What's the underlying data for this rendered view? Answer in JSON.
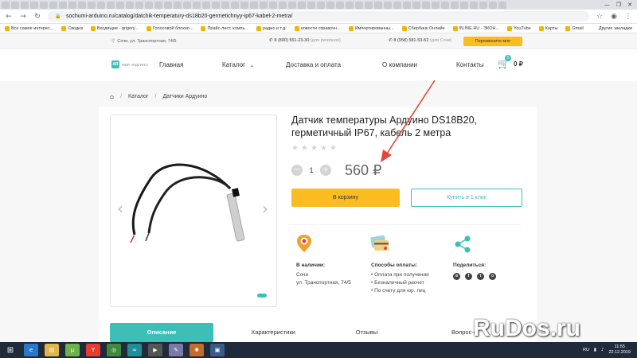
{
  "browser": {
    "url": "sochumi-arduino.ru/catalog/datchik-temperatury-ds18b20-germetichnyy-ip67-kabel-2-metra/",
    "bookmarks": [
      "Все самое интерес...",
      "Сводка",
      "Входящие - grigory...",
      "Голосовой блокно...",
      "Прайс-лист, компь...",
      "радио и т.д.",
      "новости справочн...",
      "Импортированны...",
      "Сбербанк Онлайн",
      "IN.INE.RU - ЭКОН...",
      "YouTube",
      "Карты",
      "Gmail"
    ],
    "bookmarks_last": "Другие закладки"
  },
  "topbar": {
    "address": "Сочи, ул. Транспортная, 74/5",
    "phone1": "8 (800) 551-23-30",
    "phone1_note": "(для регионов)",
    "phone2": "8 (958) 581-53-52",
    "phone2_note": "(для Сочи)",
    "callback": "Перезвоните мне"
  },
  "header": {
    "logo_text": "МИР АРДУИНО",
    "nav": [
      "Главная",
      "Каталог",
      "Доставка и оплата",
      "О компании",
      "Контакты"
    ],
    "cart_count": "0",
    "cart_sum": "0 ₽"
  },
  "breadcrumbs": [
    "Каталог",
    "Датчики Ардуино"
  ],
  "product": {
    "title": "Датчик температуры Ардуино DS18B20, герметичный IP67, кабель 2 метра",
    "qty": "1",
    "price": "560 ₽",
    "add_to_cart": "В корзину",
    "buy_one_click": "Купить в 1 клик"
  },
  "info": {
    "stock_title": "В наличии:",
    "stock_city": "Сочи",
    "stock_address": "ул. Транспортная, 74/5",
    "pay_title": "Способы оплаты:",
    "pay_methods": [
      "Оплата при получении",
      "Безналичный расчет",
      "По счету для юр. лиц"
    ],
    "share_title": "Поделиться:"
  },
  "tabs": [
    "Описание",
    "Характеристики",
    "Отзывы",
    "Вопрос-о"
  ],
  "watermark": "RuDos.ru",
  "taskbar": {
    "lang": "RU",
    "time": "11:55",
    "date": "22.12.2019"
  },
  "colors": {
    "accent": "#3dbfb8",
    "button_yellow": "#fbbc22",
    "arrow": "#e0483a"
  }
}
